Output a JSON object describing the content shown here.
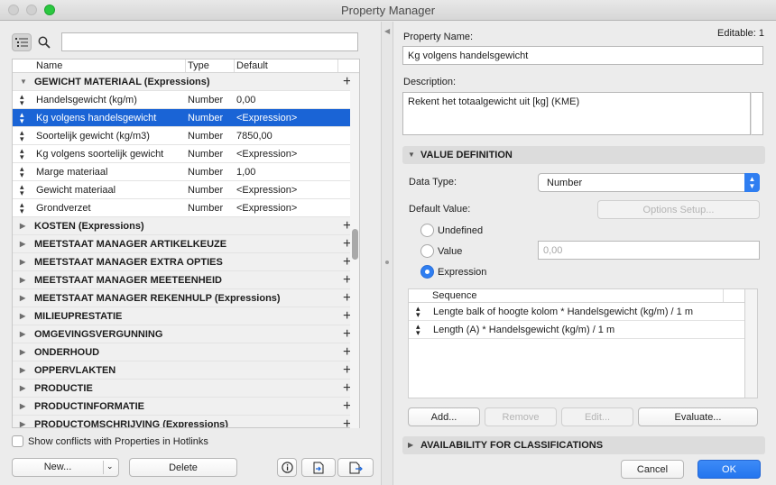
{
  "window": {
    "title": "Property Manager"
  },
  "left": {
    "search": {
      "value": "",
      "placeholder": ""
    },
    "columns": {
      "name": "Name",
      "type": "Type",
      "default": "Default"
    },
    "groups": [
      {
        "label": "GEWICHT MATERIAAL (Expressions)",
        "expanded": true,
        "items": [
          {
            "name": "Handelsgewicht (kg/m)",
            "type": "Number",
            "default": "0,00"
          },
          {
            "name": "Kg volgens handelsgewicht",
            "type": "Number",
            "default": "<Expression>",
            "selected": true
          },
          {
            "name": "Soortelijk gewicht (kg/m3)",
            "type": "Number",
            "default": "7850,00"
          },
          {
            "name": "Kg volgens soortelijk gewicht",
            "type": "Number",
            "default": "<Expression>"
          },
          {
            "name": "Marge materiaal",
            "type": "Number",
            "default": "1,00"
          },
          {
            "name": "Gewicht materiaal",
            "type": "Number",
            "default": "<Expression>"
          },
          {
            "name": "Grondverzet",
            "type": "Number",
            "default": "<Expression>"
          }
        ]
      },
      {
        "label": "KOSTEN (Expressions)"
      },
      {
        "label": "MEETSTAAT MANAGER ARTIKELKEUZE"
      },
      {
        "label": "MEETSTAAT MANAGER EXTRA OPTIES"
      },
      {
        "label": "MEETSTAAT MANAGER MEETEENHEID"
      },
      {
        "label": "MEETSTAAT MANAGER REKENHULP (Expressions)"
      },
      {
        "label": "MILIEUPRESTATIE"
      },
      {
        "label": "OMGEVINGSVERGUNNING"
      },
      {
        "label": "ONDERHOUD"
      },
      {
        "label": "OPPERVLAKTEN"
      },
      {
        "label": "PRODUCTIE"
      },
      {
        "label": "PRODUCTINFORMATIE"
      },
      {
        "label": "PRODUCTOMSCHRIJVING (Expressions)"
      }
    ],
    "show_conflicts_label": "Show conflicts with Properties in Hotlinks",
    "new_label": "New...",
    "delete_label": "Delete"
  },
  "right": {
    "editable": "Editable: 1",
    "property_name_label": "Property Name:",
    "property_name_value": "Kg volgens handelsgewicht",
    "description_label": "Description:",
    "description_value": "Rekent het totaalgewicht uit [kg] (KME)",
    "value_definition_label": "VALUE DEFINITION",
    "data_type_label": "Data Type:",
    "data_type_value": "Number",
    "default_value_label": "Default Value:",
    "options_setup_label": "Options Setup...",
    "radio_undefined": "Undefined",
    "radio_value": "Value",
    "radio_expression": "Expression",
    "value_placeholder": "0,00",
    "sequence_header": "Sequence",
    "sequence": [
      "Lengte balk of hoogte kolom * Handelsgewicht (kg/m) / 1 m",
      "Length (A) * Handelsgewicht (kg/m) / 1 m"
    ],
    "add_label": "Add...",
    "remove_label": "Remove",
    "edit_label": "Edit...",
    "evaluate_label": "Evaluate...",
    "availability_label": "AVAILABILITY FOR CLASSIFICATIONS",
    "cancel_label": "Cancel",
    "ok_label": "OK"
  },
  "colors": {
    "accent": "#1a64d6",
    "ok_button": "#2f7ef1"
  },
  "icons": [
    "list-view-icon",
    "search-icon",
    "info-icon",
    "import-icon",
    "export-icon",
    "plus-icon",
    "sort-handle-icon",
    "disclosure-triangle-icon"
  ]
}
